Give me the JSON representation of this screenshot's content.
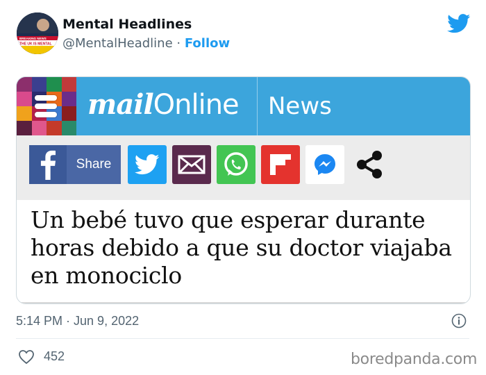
{
  "author": {
    "name": "Mental Headlines",
    "handle": "@MentalHeadline",
    "separator": "·",
    "follow_label": "Follow",
    "avatar_text": "THE UK IS MENTAL",
    "avatar_tag": "BREAKING NEWS"
  },
  "card": {
    "brand_mail": "mail",
    "brand_online": "Online",
    "section": "News",
    "share_label": "Share",
    "share_buttons": [
      "facebook-icon",
      "twitter-icon",
      "email-icon",
      "whatsapp-icon",
      "flipboard-icon",
      "messenger-icon",
      "share-icon"
    ],
    "headline": "Un bebé tuvo que esperar durante horas debido a que su doctor viajaba en monociclo"
  },
  "tweet": {
    "timestamp": "5:14 PM · Jun 9, 2022",
    "likes": "452"
  },
  "watermark": "boredpanda.com",
  "colors": {
    "twitter_blue": "#1d9bf0",
    "mail_blue": "#3ca5dc",
    "facebook": "#3b5998",
    "whatsapp": "#43c553",
    "flipboard": "#e4332e",
    "email": "#5a2a4d"
  }
}
